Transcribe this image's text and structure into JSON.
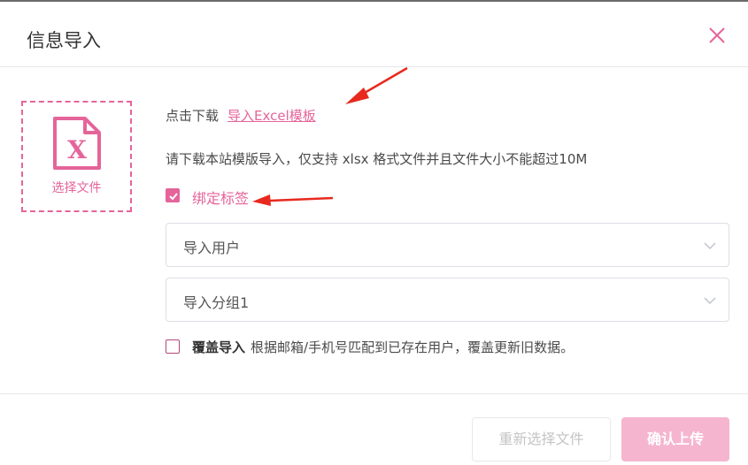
{
  "dialog": {
    "title": "信息导入",
    "close_icon": "close-icon"
  },
  "upload": {
    "icon": "excel-file-icon",
    "icon_letter": "X",
    "label": "选择文件"
  },
  "template": {
    "prefix": "点击下载",
    "link_label": "导入Excel模板"
  },
  "hint": "请下载本站模版导入，仅支持 xlsx 格式文件并且文件大小不能超过10M",
  "bind_tag": {
    "label": "绑定标签",
    "checked": true
  },
  "selects": {
    "user": {
      "value": "导入用户"
    },
    "group": {
      "value": "导入分组1"
    }
  },
  "overwrite": {
    "checked": false,
    "label": "覆盖导入",
    "description": "根据邮箱/手机号匹配到已存在用户，覆盖更新旧数据。"
  },
  "footer": {
    "reselect_label": "重新选择文件",
    "confirm_label": "确认上传"
  },
  "colors": {
    "accent": "#e5649a",
    "accent_light": "#f6b5cf",
    "annotation_arrow": "#e8291e"
  }
}
